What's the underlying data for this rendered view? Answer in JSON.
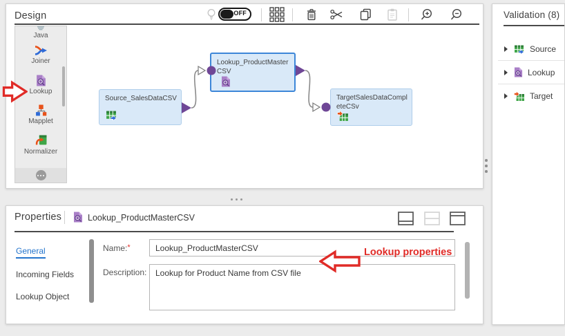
{
  "design": {
    "title": "Design",
    "toolbar": {
      "toggle": {
        "state": "OFF"
      },
      "icons": [
        "bulb",
        "grid",
        "delete",
        "cut",
        "copy",
        "paste",
        "zoom-in",
        "zoom-out"
      ]
    },
    "palette": {
      "items": [
        {
          "label": "Java",
          "icon": "java-icon"
        },
        {
          "label": "Joiner",
          "icon": "joiner-icon"
        },
        {
          "label": "Lookup",
          "icon": "lookup-icon"
        },
        {
          "label": "Mapplet",
          "icon": "mapplet-icon"
        },
        {
          "label": "Normalizer",
          "icon": "normalizer-icon"
        }
      ],
      "more_icon": "ellipsis"
    },
    "canvas": {
      "nodes": [
        {
          "label": "Source_SalesDataCSV",
          "type": "source"
        },
        {
          "label": "Lookup_ProductMasterCSV",
          "type": "lookup",
          "selected": true
        },
        {
          "label": "TargetSalesDataCompleteCSv",
          "type": "target"
        }
      ]
    }
  },
  "validation": {
    "title": "Validation (8)",
    "items": [
      {
        "label": "Source",
        "icon": "source-icon"
      },
      {
        "label": "Lookup",
        "icon": "lookup-icon"
      },
      {
        "label": "Target",
        "icon": "target-icon"
      }
    ]
  },
  "properties": {
    "panel_title": "Properties",
    "selected_title": "Lookup_ProductMasterCSV",
    "tabs": [
      {
        "label": "General",
        "active": true
      },
      {
        "label": "Incoming Fields",
        "active": false
      },
      {
        "label": "Lookup Object",
        "active": false
      }
    ],
    "form": {
      "name_label": "Name:",
      "required_marker": "*",
      "name_value": "Lookup_ProductMasterCSV",
      "description_label": "Description:",
      "description_value": "Lookup for Product Name from CSV file"
    }
  },
  "annotations": {
    "lookup_properties_label": "Lookup properties"
  },
  "colors": {
    "annotation_red": "#e02b27",
    "node_fill": "#d9e9f8",
    "node_border_selected": "#3c86d8",
    "port_purple": "#6f4796",
    "accent_blue": "#2374cc",
    "icon_green": "#3fa648",
    "icon_orange": "#e8521a"
  }
}
